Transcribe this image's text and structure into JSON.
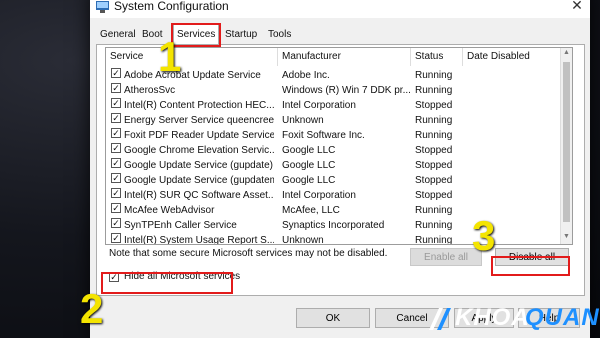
{
  "window": {
    "title": "System Configuration",
    "close_glyph": "✕"
  },
  "tabs": [
    {
      "label": "General",
      "active": false
    },
    {
      "label": "Boot",
      "active": false
    },
    {
      "label": "Services",
      "active": true
    },
    {
      "label": "Startup",
      "active": false
    },
    {
      "label": "Tools",
      "active": false
    }
  ],
  "columns": {
    "service": "Service",
    "manufacturer": "Manufacturer",
    "status": "Status",
    "date_disabled": "Date Disabled"
  },
  "services": [
    {
      "name": "Adobe Acrobat Update Service",
      "manufacturer": "Adobe Inc.",
      "status": "Running",
      "checked": true
    },
    {
      "name": "AtherosSvc",
      "manufacturer": "Windows (R) Win 7 DDK pr...",
      "status": "Running",
      "checked": true
    },
    {
      "name": "Intel(R) Content Protection HEC...",
      "manufacturer": "Intel Corporation",
      "status": "Stopped",
      "checked": true
    },
    {
      "name": "Energy Server Service queencreek",
      "manufacturer": "Unknown",
      "status": "Running",
      "checked": true
    },
    {
      "name": "Foxit PDF Reader Update Service",
      "manufacturer": "Foxit Software Inc.",
      "status": "Running",
      "checked": true
    },
    {
      "name": "Google Chrome Elevation Servic...",
      "manufacturer": "Google LLC",
      "status": "Stopped",
      "checked": true
    },
    {
      "name": "Google Update Service (gupdate)",
      "manufacturer": "Google LLC",
      "status": "Stopped",
      "checked": true
    },
    {
      "name": "Google Update Service (gupdatem)",
      "manufacturer": "Google LLC",
      "status": "Stopped",
      "checked": true
    },
    {
      "name": "Intel(R) SUR QC Software Asset...",
      "manufacturer": "Intel Corporation",
      "status": "Stopped",
      "checked": true
    },
    {
      "name": "McAfee WebAdvisor",
      "manufacturer": "McAfee, LLC",
      "status": "Running",
      "checked": true
    },
    {
      "name": "SynTPEnh Caller Service",
      "manufacturer": "Synaptics Incorporated",
      "status": "Running",
      "checked": true
    },
    {
      "name": "Intel(R) System Usage Report S...",
      "manufacturer": "Unknown",
      "status": "Running",
      "checked": true
    }
  ],
  "note": "Note that some secure Microsoft services may not be disabled.",
  "buttons": {
    "enable_all": "Enable all",
    "disable_all": "Disable all",
    "ok": "OK",
    "cancel": "Cancel",
    "apply": "Apply",
    "help": "Help"
  },
  "hide_ms": {
    "label": "Hide all Microsoft services",
    "checked": true
  },
  "step_numbers": [
    "1",
    "2",
    "3"
  ],
  "brand": {
    "part1": "KHOA",
    "part2": "QUAN",
    "accent_color": "#1e90ff"
  },
  "highlight_color": "#e21b1b",
  "step_color": "#f4e400"
}
